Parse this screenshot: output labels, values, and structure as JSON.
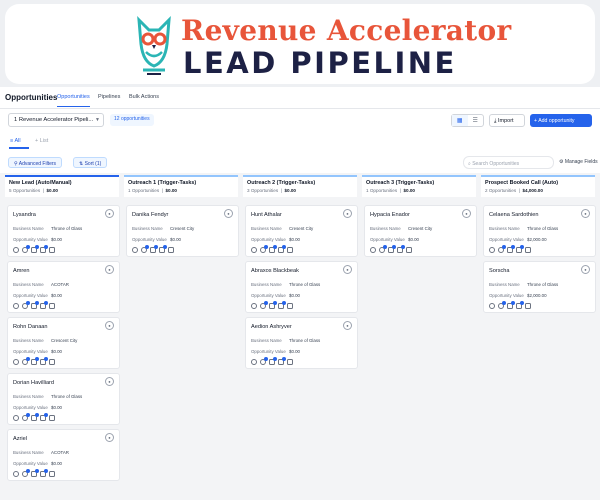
{
  "banner": {
    "line1": "Revenue Accelerator",
    "line2": "LEAD PIPELINE",
    "colors": {
      "accent": "#e8553a",
      "navy": "#1d2145",
      "teal": "#2bb5b5"
    }
  },
  "nav": {
    "brand": "Opportunities",
    "tabs": [
      "Opportunities",
      "Pipelines",
      "Bulk Actions"
    ]
  },
  "toolbar": {
    "pipeline": "1 Revenue Accelerator Pipeli...",
    "count_badge": "12 opportunities",
    "import_label": "Import",
    "add_label": "Add opportunity"
  },
  "subtabs": {
    "all": "All",
    "list": "List"
  },
  "filters": {
    "advanced": "Advanced Filters",
    "sort": "Sort (1)",
    "search_placeholder": "Search Opportunities",
    "manage_fields": "Manage Fields"
  },
  "labels": {
    "business_name": "Business Name",
    "opportunity_value": "Opportunity Value"
  },
  "columns": [
    {
      "name": "New Lead (Auto/Manual)",
      "count": "5 Opportunities",
      "value": "$0.00",
      "cards": [
        {
          "name": "Lysandra",
          "business": "Throne of Glass",
          "value": "$0.00"
        },
        {
          "name": "Amren",
          "business": "ACOTAR",
          "value": "$0.00"
        },
        {
          "name": "Rohn Danaan",
          "business": "Crescent City",
          "value": "$0.00"
        },
        {
          "name": "Dorian Havilliard",
          "business": "Throne of Glass",
          "value": "$0.00"
        },
        {
          "name": "Azriel",
          "business": "ACOTAR",
          "value": "$0.00"
        }
      ]
    },
    {
      "name": "Outreach 1 (Trigger-Tasks)",
      "count": "1 Opportunities",
      "value": "$0.00",
      "cards": [
        {
          "name": "Danika Fendyr",
          "business": "Cresent City",
          "value": "$0.00"
        }
      ]
    },
    {
      "name": "Outreach 2 (Trigger-Tasks)",
      "count": "3 Opportunities",
      "value": "$0.00",
      "cards": [
        {
          "name": "Hunt Athalar",
          "business": "Cresent City",
          "value": "$0.00"
        },
        {
          "name": "Abraxos Blackbeak",
          "business": "Throne of Glass",
          "value": "$0.00"
        },
        {
          "name": "Aedion Ashryver",
          "business": "Throne of Glass",
          "value": "$0.00"
        }
      ]
    },
    {
      "name": "Outreach 3 (Trigger-Tasks)",
      "count": "1 Opportunities",
      "value": "$0.00",
      "cards": [
        {
          "name": "Hypacia Enador",
          "business": "Cresent City",
          "value": "$0.00"
        }
      ]
    },
    {
      "name": "Prospect Booked Call (Auto)",
      "count": "2 Opportunities",
      "value": "$4,000.00",
      "cards": [
        {
          "name": "Celaena Sardothien",
          "business": "Throne of Glass",
          "value": "$2,000.00"
        },
        {
          "name": "Sorscha",
          "business": "Throne of Glass",
          "value": "$2,000.00"
        }
      ]
    }
  ]
}
